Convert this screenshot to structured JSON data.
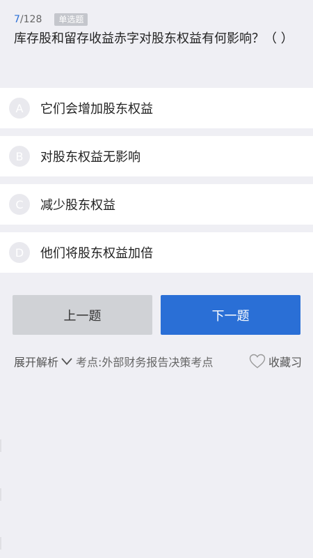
{
  "header": {
    "current": "7",
    "total": "/128",
    "type_label": "单选题",
    "question": "库存股和留存收益赤字对股东权益有何影响？（  ）"
  },
  "options": [
    {
      "letter": "A",
      "text": "它们会增加股东权益"
    },
    {
      "letter": "B",
      "text": "对股东权益无影响"
    },
    {
      "letter": "C",
      "text": "减少股东权益"
    },
    {
      "letter": "D",
      "text": "他们将股东权益加倍"
    }
  ],
  "buttons": {
    "prev": "上一题",
    "next": "下一题"
  },
  "footer": {
    "expand_label": "展开解析",
    "kaodian": "考点:外部财务报告决策考点",
    "favorite": "收藏习"
  },
  "colors": {
    "accent": "#2a6fd6",
    "background": "#efeff4",
    "prev_button": "#d0d2d6"
  },
  "icons": {
    "expand": "chevron-down-icon",
    "favorite": "heart-outline-icon"
  }
}
